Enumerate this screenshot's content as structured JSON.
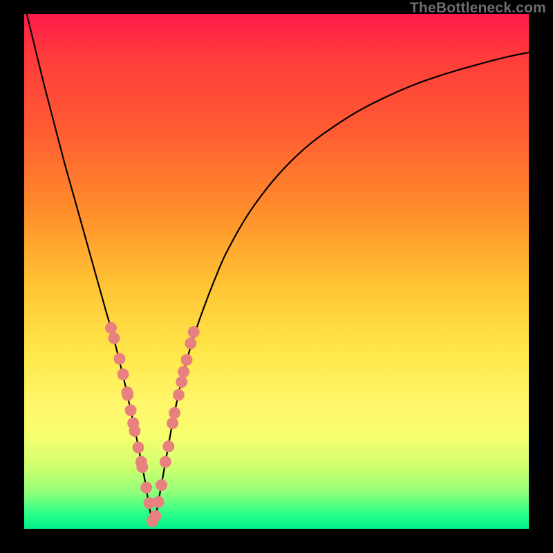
{
  "watermark": "TheBottleneck.com",
  "chart_data": {
    "type": "line",
    "title": "",
    "xlabel": "",
    "ylabel": "",
    "xlim": [
      0,
      100
    ],
    "ylim": [
      0,
      100
    ],
    "minimum_x": 25.5,
    "series": [
      {
        "name": "bottleneck-curve",
        "x": [
          0.5,
          2,
          4,
          6,
          8,
          10,
          12,
          14,
          16,
          18,
          20,
          21,
          22,
          23,
          24,
          24.5,
          25,
          25.5,
          26,
          26.5,
          27,
          28,
          29,
          30,
          31,
          32,
          34,
          36,
          38,
          40,
          44,
          48,
          52,
          56,
          60,
          66,
          72,
          78,
          84,
          90,
          96,
          100
        ],
        "values": [
          100,
          94,
          86,
          78.5,
          71,
          64,
          57,
          50,
          43,
          36,
          28,
          23.5,
          19,
          14,
          9,
          6,
          3.2,
          0.8,
          2.2,
          4.8,
          7.5,
          13,
          18.5,
          23.5,
          28,
          32,
          38.5,
          44,
          49,
          53.5,
          60.5,
          66,
          70.5,
          74.2,
          77.2,
          81,
          84,
          86.5,
          88.5,
          90.2,
          91.7,
          92.5
        ]
      }
    ],
    "highlight_points": {
      "name": "sample-dots",
      "x": [
        17.2,
        17.8,
        18.9,
        19.6,
        20.4,
        20.5,
        21.1,
        21.6,
        21.9,
        22.6,
        23.2,
        23.4,
        24.2,
        24.8,
        25.4,
        26.0,
        26.6,
        27.2,
        28.0,
        28.6,
        29.4,
        29.8,
        30.6,
        31.2,
        31.6,
        32.2,
        33.0,
        33.6
      ],
      "values": [
        39.0,
        37.0,
        33.0,
        30.0,
        26.5,
        26.0,
        23.0,
        20.5,
        19.0,
        15.8,
        13.0,
        12.0,
        8.0,
        5.0,
        1.5,
        2.5,
        5.2,
        8.5,
        13.0,
        16.0,
        20.5,
        22.5,
        26.0,
        28.5,
        30.5,
        32.8,
        36.0,
        38.2
      ]
    }
  },
  "colors": {
    "curve_stroke": "#000000",
    "dot_fill": "#e98080"
  }
}
